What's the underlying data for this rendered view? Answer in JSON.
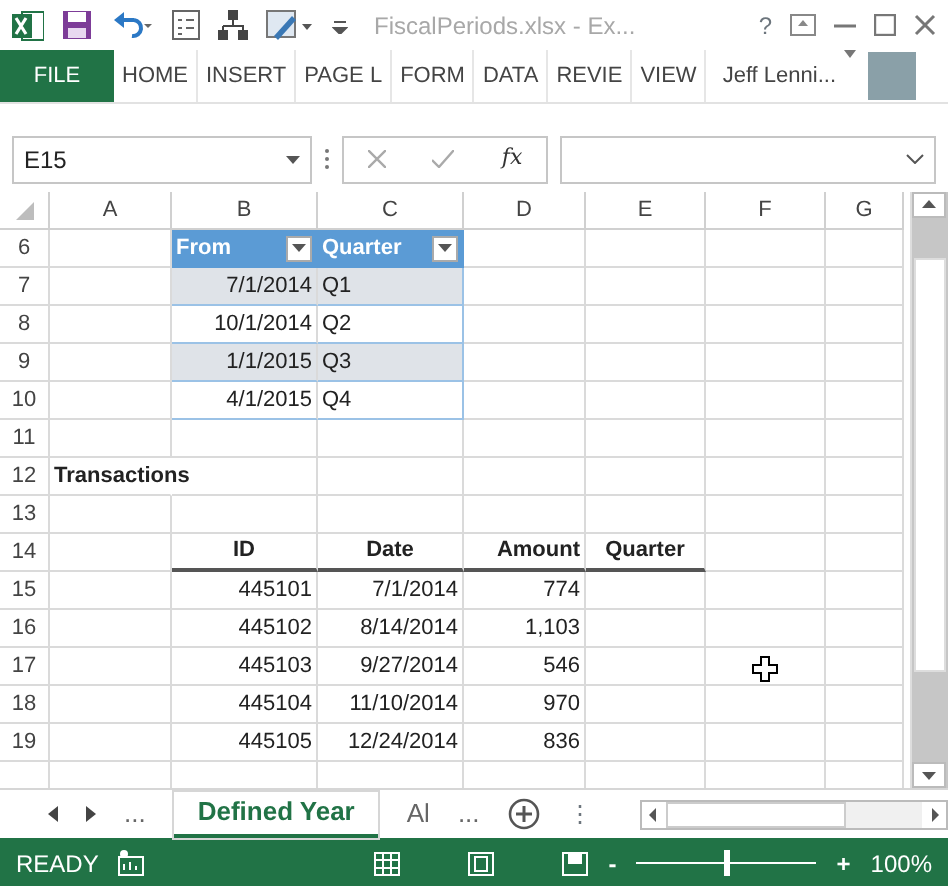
{
  "title_bar": {
    "title": "FiscalPeriods.xlsx - Ex...",
    "help": "?"
  },
  "ribbon_tabs": [
    {
      "label": "FILE",
      "kind": "file",
      "selected": false
    },
    {
      "label": "HOME",
      "kind": "tab",
      "selected": false
    },
    {
      "label": "INSERT",
      "kind": "tab",
      "selected": false
    },
    {
      "label": "PAGE L",
      "kind": "tab",
      "selected": false
    },
    {
      "label": "FORM",
      "kind": "tab",
      "selected": false
    },
    {
      "label": "DATA",
      "kind": "tab",
      "selected": false
    },
    {
      "label": "REVIE",
      "kind": "tab",
      "selected": false
    },
    {
      "label": "VIEW",
      "kind": "tab",
      "selected": false
    }
  ],
  "user": "Jeff Lenni...",
  "formula_bar": {
    "name_box": "E15",
    "function_label": "fx"
  },
  "columns": [
    "A",
    "B",
    "C",
    "D",
    "E",
    "F",
    "G"
  ],
  "rows": [
    {
      "number": "6",
      "kind": "table_header",
      "cells": {
        "B": "From",
        "C": "Quarter"
      }
    },
    {
      "number": "7",
      "kind": "table_row",
      "banded": true,
      "cells": {
        "B": "7/1/2014",
        "C": "Q1"
      }
    },
    {
      "number": "8",
      "kind": "table_row",
      "banded": false,
      "cells": {
        "B": "10/1/2014",
        "C": "Q2"
      }
    },
    {
      "number": "9",
      "kind": "table_row",
      "banded": true,
      "cells": {
        "B": "1/1/2015",
        "C": "Q3"
      }
    },
    {
      "number": "10",
      "kind": "table_row",
      "banded": false,
      "cells": {
        "B": "4/1/2015",
        "C": "Q4"
      }
    },
    {
      "number": "11",
      "kind": "blank"
    },
    {
      "number": "12",
      "kind": "title",
      "cells": {
        "A": "Transactions"
      }
    },
    {
      "number": "13",
      "kind": "blank"
    },
    {
      "number": "14",
      "kind": "header",
      "cells": {
        "B": "ID",
        "C": "Date",
        "D": "Amount",
        "E": "Quarter"
      }
    },
    {
      "number": "15",
      "kind": "data",
      "cells": {
        "B": "445101",
        "C": "7/1/2014",
        "D": "774"
      }
    },
    {
      "number": "16",
      "kind": "data",
      "cells": {
        "B": "445102",
        "C": "8/14/2014",
        "D": "1,103"
      }
    },
    {
      "number": "17",
      "kind": "data",
      "cells": {
        "B": "445103",
        "C": "9/27/2014",
        "D": "546"
      }
    },
    {
      "number": "18",
      "kind": "data",
      "cells": {
        "B": "445104",
        "C": "11/10/2014",
        "D": "970"
      }
    },
    {
      "number": "19",
      "kind": "data",
      "cells": {
        "B": "445105",
        "C": "12/24/2014",
        "D": "836"
      }
    }
  ],
  "sheet_tabs": {
    "more_left": "...",
    "tabs": [
      {
        "label": "Defined Year",
        "selected": true
      },
      {
        "label": "Al",
        "selected": false
      }
    ],
    "more_right": "...",
    "options": "⋮"
  },
  "status_bar": {
    "status": "READY",
    "zoom_minus": "-",
    "zoom_plus": "+",
    "zoom": "100%",
    "level": 0.5
  }
}
